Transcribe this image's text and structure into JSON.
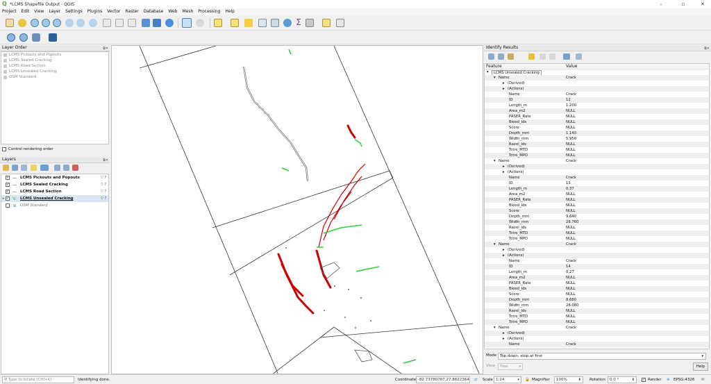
{
  "window": {
    "title": "*LCMS Shapefile Output - QGIS",
    "minimize": "–",
    "maximize": "▫",
    "close": "✕"
  },
  "menu": [
    "Project",
    "Edit",
    "View",
    "Layer",
    "Settings",
    "Plugins",
    "Vector",
    "Raster",
    "Database",
    "Web",
    "Mesh",
    "Processing",
    "Help"
  ],
  "layer_order": {
    "title": "Layer Order",
    "items": [
      "LCMS Pickouts and Popouts",
      "LCMS Sealed Cracking",
      "LCMS Road Section",
      "LCMS Unsealed Cracking",
      "OSM Standard"
    ],
    "control_rendering": "Control rendering order"
  },
  "layers": {
    "title": "Layers",
    "items": [
      {
        "name": "LCMS Pickouts and Popouts",
        "checked": true,
        "symbol": "—"
      },
      {
        "name": "LCMS Sealed Cracking",
        "checked": true,
        "symbol": "—"
      },
      {
        "name": "LCMS Road Section",
        "checked": true,
        "symbol": "—"
      },
      {
        "name": "LCMS Unsealed Cracking",
        "checked": true,
        "symbol": "V."
      },
      {
        "name": "OSM Standard",
        "checked": false,
        "symbol": "⊞"
      }
    ]
  },
  "identify": {
    "title": "Identify Results",
    "col_feature": "Feature",
    "col_value": "Value",
    "layer_name": "LCMS Unsealed Cracking",
    "features": [
      {
        "name_value": "Crack",
        "attrs": [
          [
            "Name",
            "Crack"
          ],
          [
            "ID",
            "12"
          ],
          [
            "Length_m",
            "1.200"
          ],
          [
            "Area_m2",
            "NULL"
          ],
          [
            "PASER_Rate",
            "NULL"
          ],
          [
            "Bleed_Ids",
            "NULL"
          ],
          [
            "Score",
            "NULL"
          ],
          [
            "Depth_mm",
            "1.140"
          ],
          [
            "Width_mm",
            "5.950"
          ],
          [
            "Ravel_Ids",
            "NULL"
          ],
          [
            "Tctre_MTD",
            "NULL"
          ],
          [
            "Tctre_MPD",
            "NULL"
          ]
        ]
      },
      {
        "name_value": "Crack",
        "attrs": [
          [
            "Name",
            "Crack"
          ],
          [
            "ID",
            "13"
          ],
          [
            "Length_m",
            "0.37"
          ],
          [
            "Area_m2",
            "NULL"
          ],
          [
            "PASER_Rate",
            "NULL"
          ],
          [
            "Bleed_Ids",
            "NULL"
          ],
          [
            "Score",
            "NULL"
          ],
          [
            "Depth_mm",
            "9.640"
          ],
          [
            "Width_mm",
            "28.760"
          ],
          [
            "Ravel_Ids",
            "NULL"
          ],
          [
            "Tctre_MTD",
            "NULL"
          ],
          [
            "Tctre_MPD",
            "NULL"
          ]
        ]
      },
      {
        "name_value": "Crack",
        "attrs": [
          [
            "Name",
            "Crack"
          ],
          [
            "ID",
            "14"
          ],
          [
            "Length_m",
            "0.27"
          ],
          [
            "Area_m2",
            "NULL"
          ],
          [
            "PASER_Rate",
            "NULL"
          ],
          [
            "Bleed_Ids",
            "NULL"
          ],
          [
            "Score",
            "NULL"
          ],
          [
            "Depth_mm",
            "8.680"
          ],
          [
            "Width_mm",
            "28.080"
          ],
          [
            "Ravel_Ids",
            "NULL"
          ],
          [
            "Tctre_MTD",
            "NULL"
          ],
          [
            "Tctre_MPD",
            "NULL"
          ]
        ]
      },
      {
        "name_value": "Crack",
        "attrs": [
          [
            "Name",
            "Crack"
          ]
        ]
      }
    ],
    "name_label": "Name",
    "derived_label": "(Derived)",
    "actions_label": "(Actions)",
    "mode_label": "Mode",
    "mode_value": "Top down, stop at first",
    "view_label": "View",
    "view_value": "Tree",
    "help_button": "Help"
  },
  "status": {
    "locate_placeholder": "Type to locate (Ctrl+K)",
    "message": "Identifying done.",
    "coordinate_label": "Coordinate",
    "coordinate_value": "-82.73780707,27.86223645",
    "scale_label": "Scale",
    "scale_value": "1:24",
    "magnifier_label": "Magnifier",
    "magnifier_value": "100%",
    "rotation_label": "Rotation",
    "rotation_value": "0.0 °",
    "render_label": "Render",
    "crs": "EPSG:4326"
  },
  "colors": {
    "crack_red": "#cc0000",
    "crack_green": "#33cc33",
    "outline": "#333333"
  }
}
